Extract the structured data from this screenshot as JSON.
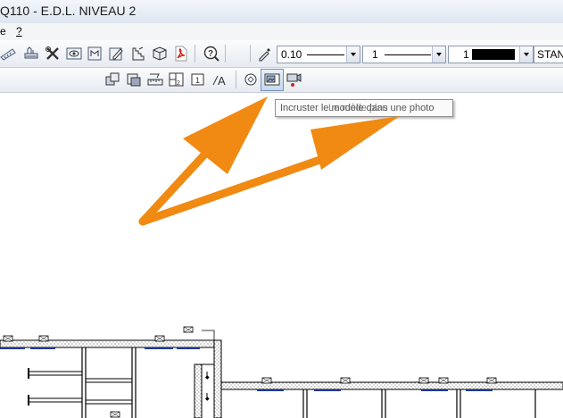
{
  "window": {
    "title": "Q110 - E.D.L. NIVEAU 2"
  },
  "menu": {
    "items": [
      "e",
      "?"
    ]
  },
  "toolbar": {
    "line_weight": "0.10",
    "line_type": "1",
    "color_index": "1",
    "color_swatch": "#000000",
    "layer_name": "STAN"
  },
  "tooltip": {
    "text": "Incruster le modèle dans une photo",
    "overlap_text": "Le mode plan"
  },
  "annotation": {
    "arrow_color": "#f08a12"
  },
  "icons": {
    "row1": [
      "measure-icon",
      "fence-icon",
      "tools-icon",
      "eye-icon",
      "mirror-icon",
      "edit-icon",
      "staircase-icon",
      "cube-icon",
      "pdf-icon",
      "help-icon",
      "eyedropper-icon"
    ],
    "row2": [
      "copy-icon",
      "layer-icon",
      "ruler-icon",
      "panel-icon",
      "number-icon",
      "text-style-icon",
      "lens-icon",
      "embed-photo-icon",
      "video-record-icon"
    ]
  }
}
